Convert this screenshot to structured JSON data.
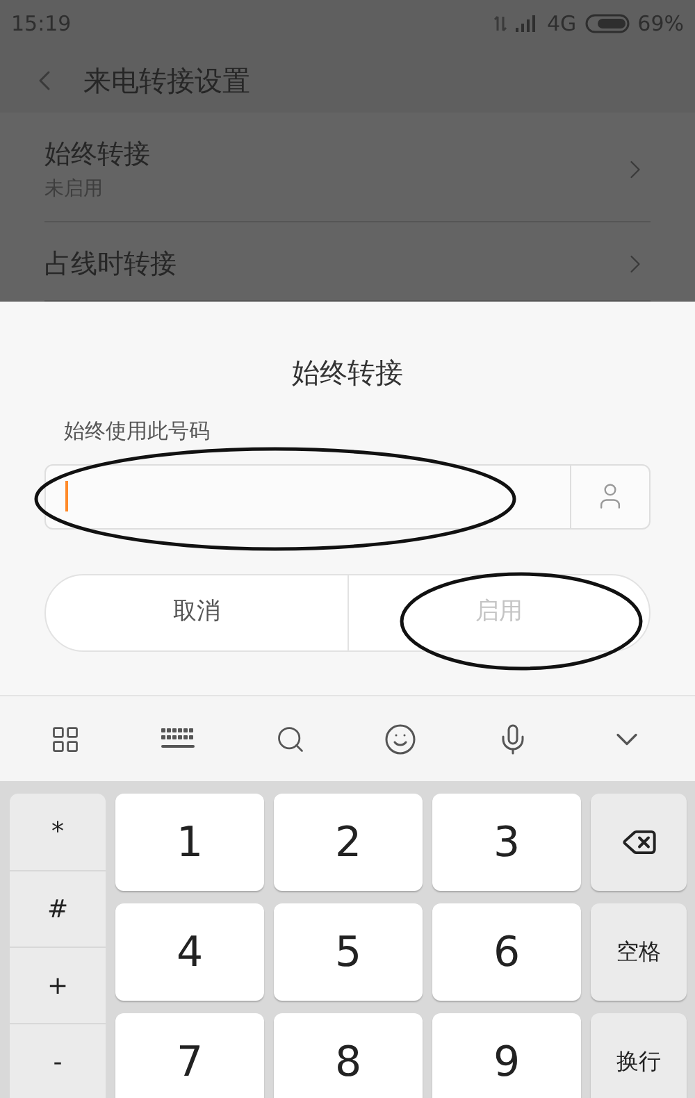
{
  "status_bar": {
    "time": "15:19",
    "network": "4G",
    "battery": "69%"
  },
  "header": {
    "title": "来电转接设置"
  },
  "settings_list": [
    {
      "title": "始终转接",
      "subtitle": "未启用"
    },
    {
      "title": "占线时转接"
    }
  ],
  "dialog": {
    "title": "始终转接",
    "field_label": "始终使用此号码",
    "buttons": [
      {
        "label": "取消",
        "disabled": false
      },
      {
        "label": "启用",
        "disabled": true
      }
    ]
  },
  "keyboard": {
    "symbol_keys": [
      "*",
      "#",
      "+",
      "-"
    ],
    "keys": [
      {
        "kind": "digit",
        "label": "1"
      },
      {
        "kind": "digit",
        "label": "2"
      },
      {
        "kind": "digit",
        "label": "3"
      },
      {
        "kind": "backspace"
      },
      {
        "kind": "digit",
        "label": "4"
      },
      {
        "kind": "digit",
        "label": "5"
      },
      {
        "kind": "digit",
        "label": "6"
      },
      {
        "kind": "function",
        "label": "空格"
      },
      {
        "kind": "digit",
        "label": "7"
      },
      {
        "kind": "digit",
        "label": "8"
      },
      {
        "kind": "digit",
        "label": "9"
      },
      {
        "kind": "function",
        "label": "换行"
      }
    ]
  }
}
